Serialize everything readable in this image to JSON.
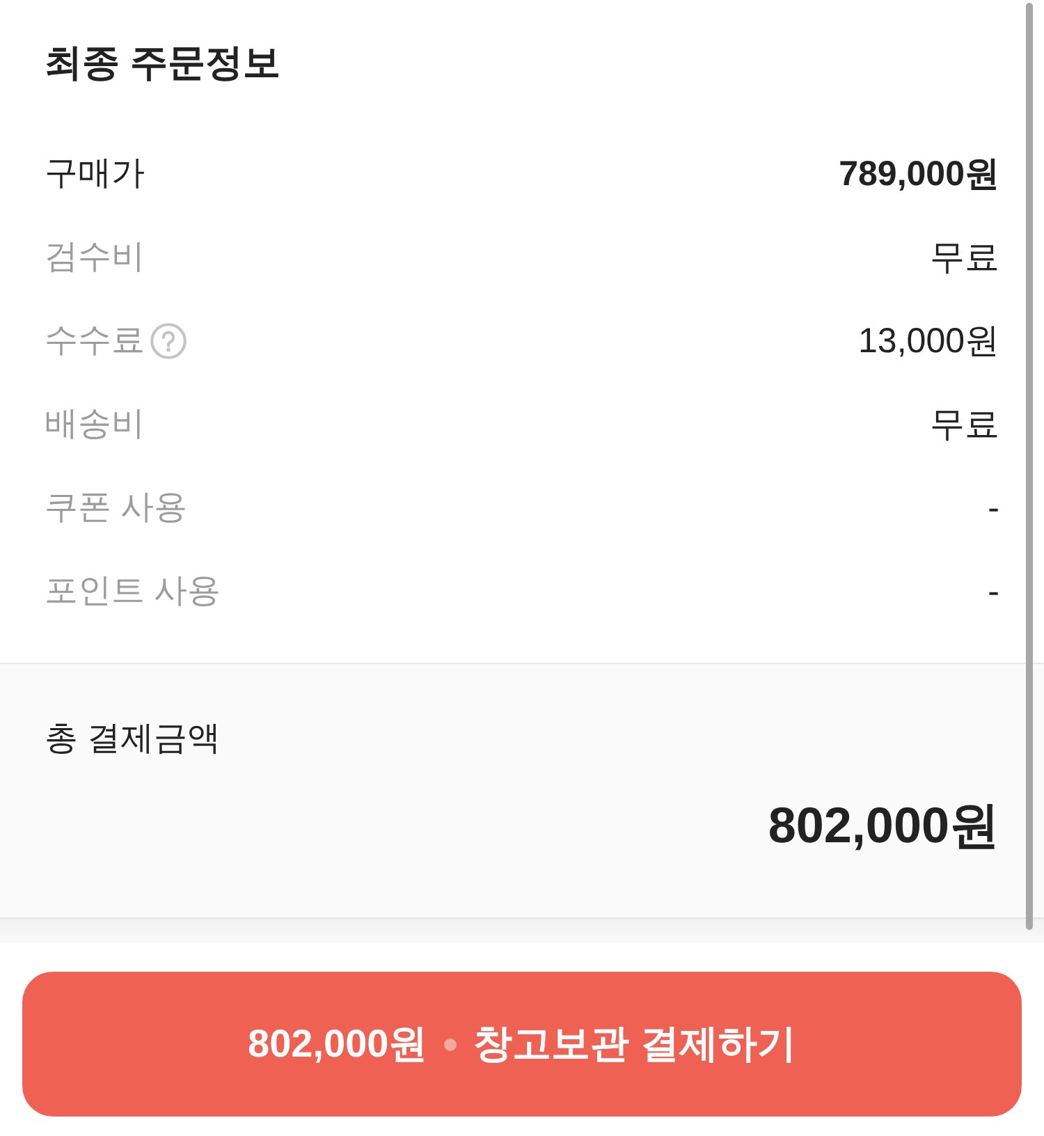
{
  "title": "최종 주문정보",
  "rows": [
    {
      "label": "구매가",
      "value": "789,000원",
      "emphasized": true,
      "help": false
    },
    {
      "label": "검수비",
      "value": "무료",
      "emphasized": false,
      "help": false
    },
    {
      "label": "수수료",
      "value": "13,000원",
      "emphasized": false,
      "help": true
    },
    {
      "label": "배송비",
      "value": "무료",
      "emphasized": false,
      "help": false
    },
    {
      "label": "쿠폰 사용",
      "value": "-",
      "emphasized": false,
      "help": false
    },
    {
      "label": "포인트 사용",
      "value": "-",
      "emphasized": false,
      "help": false
    }
  ],
  "total": {
    "label": "총 결제금액",
    "value": "802,000원"
  },
  "pay_button": {
    "amount": "802,000원",
    "action": "창고보관 결제하기"
  }
}
